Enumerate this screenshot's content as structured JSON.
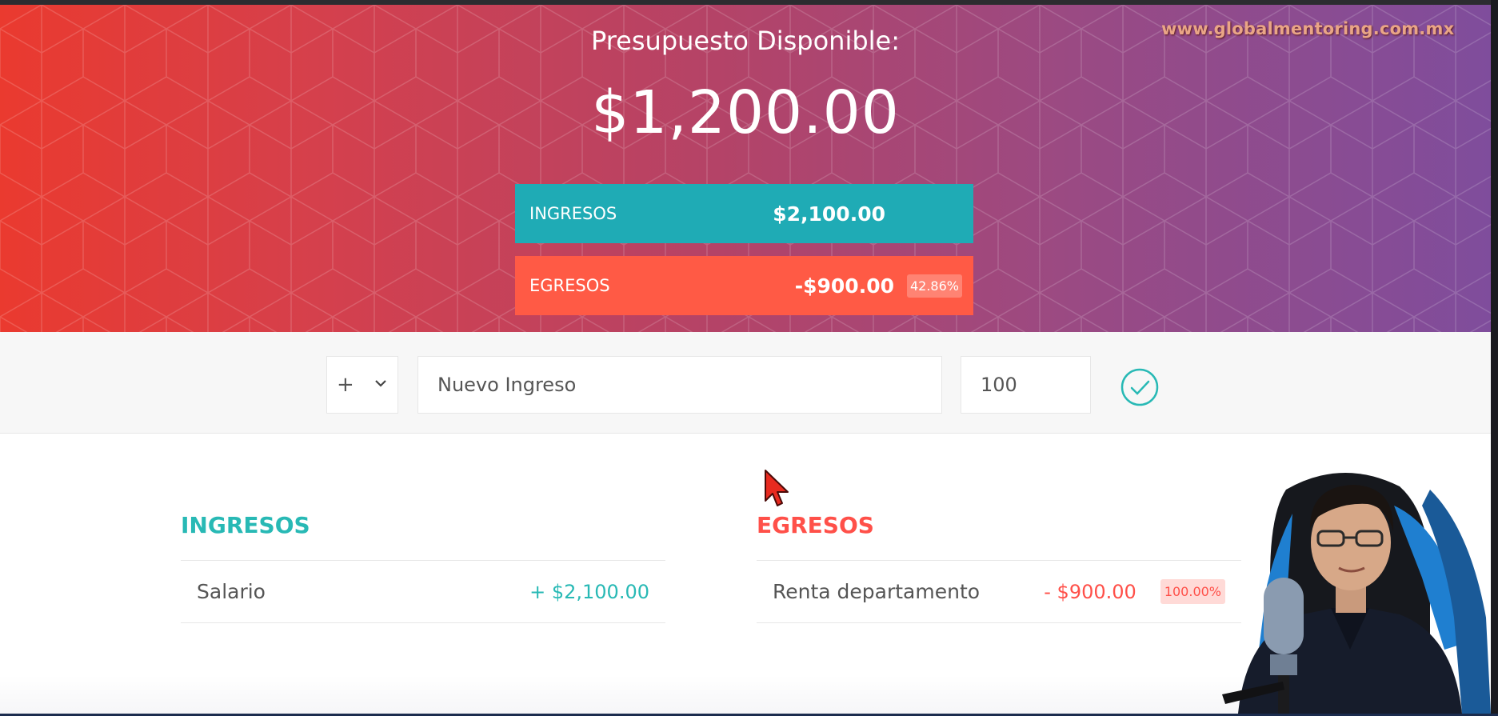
{
  "header": {
    "title": "Presupuesto Disponible:",
    "budget": "$1,200.00",
    "watermark": "www.globalmentoring.com.mx",
    "income_label": "INGRESOS",
    "income_value": "$2,100.00",
    "expense_label": "EGRESOS",
    "expense_value": "-$900.00",
    "expense_percentage": "42.86%"
  },
  "add_form": {
    "type_value": "+",
    "description_placeholder": "Nuevo Ingreso",
    "value": "100",
    "submit_icon": "check-circle-icon"
  },
  "income_list": {
    "title": "INGRESOS",
    "items": [
      {
        "description": "Salario",
        "value": "+ $2,100.00"
      }
    ]
  },
  "expense_list": {
    "title": "EGRESOS",
    "items": [
      {
        "description": "Renta departamento",
        "value": "- $900.00",
        "percentage": "100.00%"
      }
    ]
  },
  "overlays": {
    "cursor_icon": "mouse-pointer-icon",
    "webcam": "presenter-webcam"
  },
  "colors": {
    "income_accent": "#28b9b5",
    "income_bar": "#1fabb5",
    "expense_accent": "#ff5049",
    "expense_bar": "#ff5a45",
    "header_gradient_start": "#ea3a2f",
    "header_gradient_end": "#7f4d9c"
  }
}
